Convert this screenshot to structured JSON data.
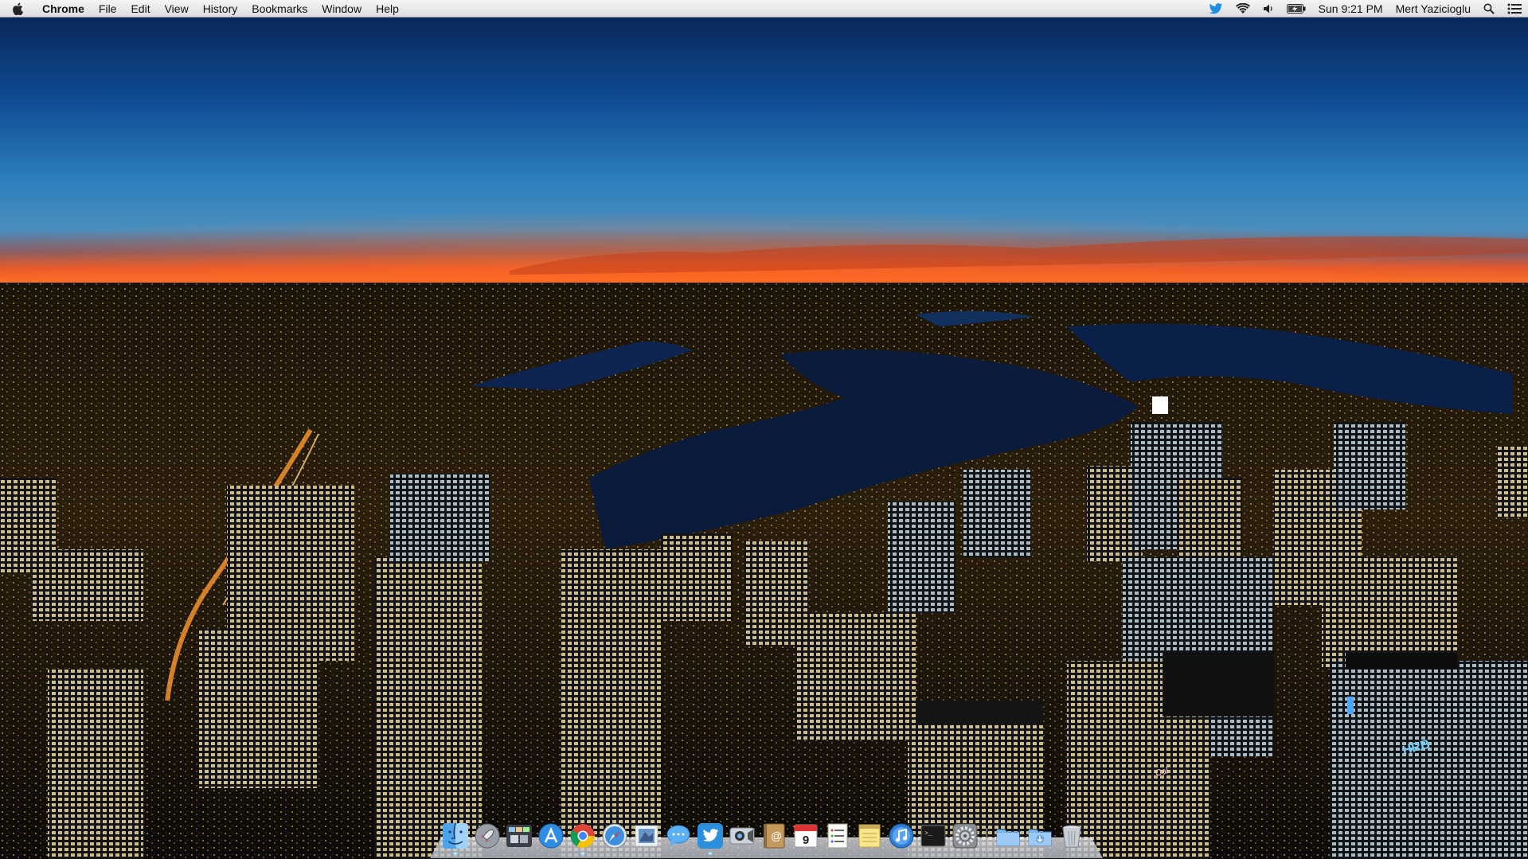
{
  "menubar": {
    "apple_icon": "apple-logo",
    "app_name": "Chrome",
    "menus": [
      "File",
      "Edit",
      "View",
      "History",
      "Bookmarks",
      "Window",
      "Help"
    ],
    "status": {
      "twitter_icon": "twitter-bird-icon",
      "wifi_icon": "wifi-icon",
      "volume_icon": "volume-icon",
      "battery_icon": "battery-charging-icon",
      "clock": "Sun 9:21 PM",
      "user": "Mert Yazicioglu",
      "spotlight_icon": "spotlight-search-icon",
      "notifications_icon": "notification-center-icon"
    }
  },
  "dock": {
    "items": [
      {
        "name": "finder",
        "icon": "finder-icon",
        "running": true
      },
      {
        "name": "launchpad",
        "icon": "launchpad-rocket-icon",
        "running": false
      },
      {
        "name": "mission-control",
        "icon": "mission-control-icon",
        "running": false
      },
      {
        "name": "app-store",
        "icon": "app-store-icon",
        "running": false
      },
      {
        "name": "chrome",
        "icon": "chrome-icon",
        "running": true
      },
      {
        "name": "safari",
        "icon": "safari-compass-icon",
        "running": false
      },
      {
        "name": "mail",
        "icon": "mail-stamp-icon",
        "running": false
      },
      {
        "name": "messages",
        "icon": "messages-bubble-icon",
        "running": false
      },
      {
        "name": "twitter",
        "icon": "twitter-bird-icon",
        "running": true
      },
      {
        "name": "facetime",
        "icon": "facetime-camera-icon",
        "running": false
      },
      {
        "name": "contacts",
        "icon": "contacts-book-icon",
        "running": false
      },
      {
        "name": "calendar",
        "icon": "calendar-icon",
        "running": false,
        "badge_text": "9"
      },
      {
        "name": "reminders",
        "icon": "reminders-list-icon",
        "running": false
      },
      {
        "name": "notes",
        "icon": "notes-pad-icon",
        "running": false
      },
      {
        "name": "itunes",
        "icon": "itunes-note-icon",
        "running": false
      },
      {
        "name": "terminal",
        "icon": "terminal-icon",
        "running": false
      },
      {
        "name": "system-preferences",
        "icon": "system-preferences-gear-icon",
        "running": false
      }
    ],
    "stack_items": [
      {
        "name": "applications-folder",
        "icon": "folder-icon"
      },
      {
        "name": "downloads-folder",
        "icon": "downloads-folder-icon"
      },
      {
        "name": "trash",
        "icon": "trash-icon"
      }
    ]
  },
  "colors": {
    "menubar_bg": "#e6e6e6",
    "sky_top": "#0b2a63",
    "sky_horizon": "#f05a1a",
    "city_lights": "#ffd27a",
    "water": "#0a1a3a"
  }
}
